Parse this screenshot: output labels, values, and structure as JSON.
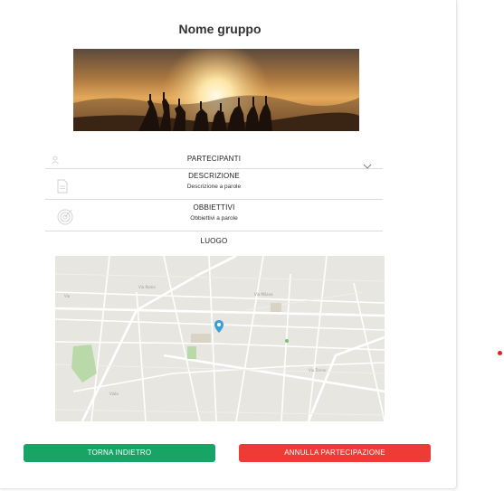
{
  "group": {
    "title": "Nome gruppo"
  },
  "sections": {
    "participants": {
      "label": "PARTECIPANTI",
      "icon": "user-icon",
      "expand_icon": "chevron-down-icon"
    },
    "description": {
      "label": "DESCRIZIONE",
      "text": "Descrizione a parole",
      "icon": "document-icon"
    },
    "objectives": {
      "label": "OBBIETTIVI",
      "text": "Obbiettivi a parole",
      "icon": "target-icon"
    },
    "location": {
      "label": "LUOGO"
    }
  },
  "actions": {
    "back_label": "TORNA INDIETRO",
    "cancel_label": "ANNULLA PARTECIPAZIONE"
  },
  "colors": {
    "back_button": "#17a566",
    "cancel_button": "#ef3b36",
    "map_pin": "#3a9fd8",
    "indicator_dot": "#e02020"
  }
}
